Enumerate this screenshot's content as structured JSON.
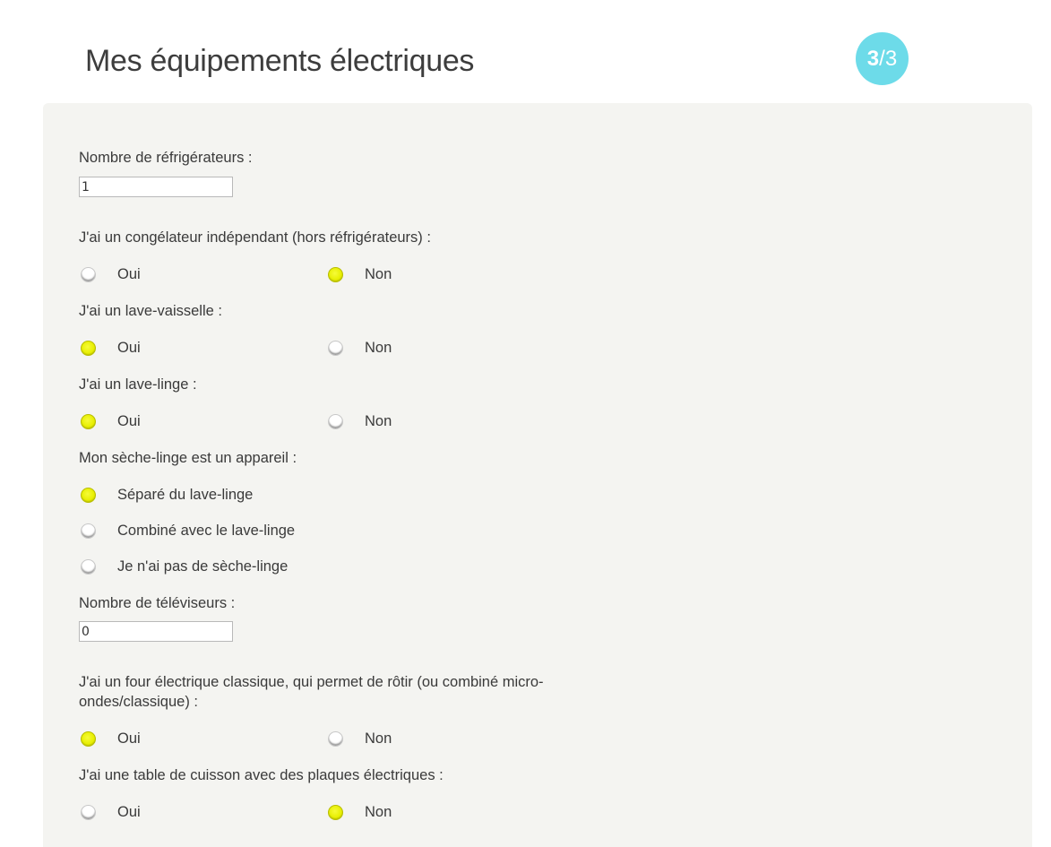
{
  "header": {
    "title": "Mes équipements électriques",
    "step_current": "3",
    "step_separator": "/",
    "step_total": "3"
  },
  "colors": {
    "accent": "#6ddbe9",
    "radio_selected": "#e7ee00",
    "panel_background": "#f4f4f1"
  },
  "form": {
    "fridges": {
      "label": "Nombre de réfrigérateurs :",
      "value": "1"
    },
    "freezer": {
      "label": "J'ai un congélateur indépendant (hors réfrigérateurs) :",
      "yes": "Oui",
      "no": "Non",
      "selected": "Non"
    },
    "dishwasher": {
      "label": "J'ai un lave-vaisselle :",
      "yes": "Oui",
      "no": "Non",
      "selected": "Oui"
    },
    "washer": {
      "label": "J'ai un lave-linge :",
      "yes": "Oui",
      "no": "Non",
      "selected": "Oui"
    },
    "dryer": {
      "label": "Mon sèche-linge est un appareil :",
      "options": [
        "Séparé du lave-linge",
        "Combiné avec le lave-linge",
        "Je n'ai pas de sèche-linge"
      ],
      "selected": "Séparé du lave-linge"
    },
    "tvs": {
      "label": "Nombre de téléviseurs :",
      "value": "0"
    },
    "oven": {
      "label": "J'ai un four électrique classique, qui permet de rôtir (ou combiné micro-ondes/classique) :",
      "yes": "Oui",
      "no": "Non",
      "selected": "Oui"
    },
    "cooktop": {
      "label": "J'ai une table de cuisson avec des plaques électriques :",
      "yes": "Oui",
      "no": "Non",
      "selected": "Non"
    }
  }
}
